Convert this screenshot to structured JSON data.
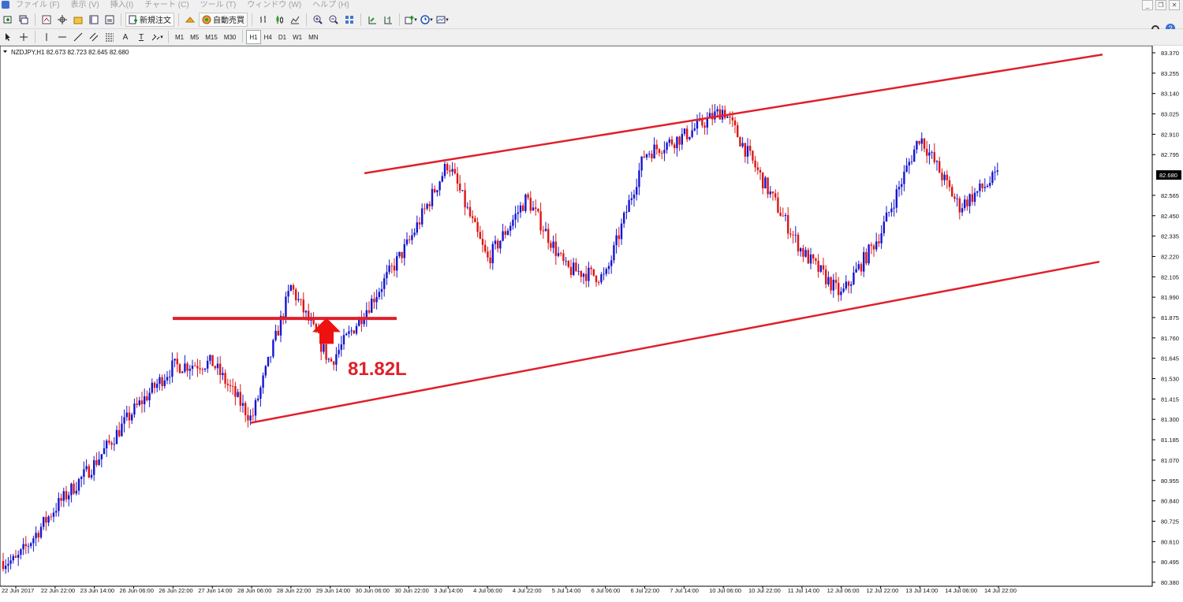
{
  "menu": {
    "items": [
      "ファイル (F)",
      "表示 (V)",
      "挿入(I)",
      "チャート (C)",
      "ツール (T)",
      "ウィンドウ (W)",
      "ヘルプ (H)"
    ]
  },
  "toolbar": {
    "new_order_label": "新規注文",
    "auto_trade_label": "自動売買",
    "draw_text_a": "A",
    "draw_text_t": "T",
    "timeframes": [
      "M1",
      "M5",
      "M15",
      "M30",
      "H1",
      "H4",
      "D1",
      "W1",
      "MN"
    ],
    "active_timeframe": "H1"
  },
  "chart": {
    "header": "NZDJPY,H1  82.673 82.723 82.645 82.680",
    "current_price": "82.680",
    "annotation": "81.82L",
    "colors": {
      "bull": "#1515d0",
      "bear": "#dd1515",
      "lines": "#e0202a",
      "arrow": "#ee1111"
    },
    "price_labels": [
      "83.370",
      "83.255",
      "83.140",
      "83.025",
      "82.910",
      "82.795",
      "82.565",
      "82.450",
      "82.335",
      "82.220",
      "82.105",
      "81.990",
      "81.875",
      "81.760",
      "81.645",
      "81.530",
      "81.415",
      "81.300",
      "81.185",
      "81.070",
      "80.955",
      "80.840",
      "80.725",
      "80.610",
      "80.495",
      "80.380"
    ],
    "time_labels": [
      "22 Jun 2017",
      "22 Jun 22:00",
      "23 Jun 14:00",
      "26 Jun 06:00",
      "26 Jun 22:00",
      "27 Jun 14:00",
      "28 Jun 06:00",
      "28 Jun 22:00",
      "29 Jun 14:00",
      "30 Jun 06:00",
      "30 Jun 22:00",
      "3 Jul 14:00",
      "4 Jul 06:00",
      "4 Jul 22:00",
      "5 Jul 14:00",
      "6 Jul 06:00",
      "6 Jul 22:00",
      "7 Jul 14:00",
      "10 Jul 06:00",
      "10 Jul 22:00",
      "11 Jul 14:00",
      "12 Jul 06:00",
      "12 Jul 22:00",
      "13 Jul 14:00",
      "14 Jul 06:00",
      "14 Jul 22:00"
    ]
  },
  "chart_data": {
    "type": "candlestick",
    "symbol": "NZDJPY",
    "timeframe": "H1",
    "ylim": [
      80.38,
      83.43
    ],
    "price_path_keypoints": [
      {
        "t": "22 Jun 2017",
        "price": 80.5
      },
      {
        "t": "22 Jun 22:00",
        "price": 80.8
      },
      {
        "t": "23 Jun 14:00",
        "price": 81.05
      },
      {
        "t": "26 Jun 06:00",
        "price": 81.35
      },
      {
        "t": "26 Jun 22:00",
        "price": 81.6
      },
      {
        "t": "27 Jun 14:00",
        "price": 81.62
      },
      {
        "t": "28 Jun 06:00",
        "price": 81.3
      },
      {
        "t": "28 Jun 22:00",
        "price": 82.05
      },
      {
        "t": "29 Jun 14:00",
        "price": 81.62
      },
      {
        "t": "30 Jun 06:00",
        "price": 81.95
      },
      {
        "t": "30 Jun 22:00",
        "price": 82.3
      },
      {
        "t": "3 Jul 14:00",
        "price": 82.75
      },
      {
        "t": "4 Jul 06:00",
        "price": 82.2
      },
      {
        "t": "4 Jul 22:00",
        "price": 82.55
      },
      {
        "t": "5 Jul 14:00",
        "price": 82.15
      },
      {
        "t": "6 Jul 06:00",
        "price": 82.1
      },
      {
        "t": "6 Jul 22:00",
        "price": 82.8
      },
      {
        "t": "7 Jul 14:00",
        "price": 82.9
      },
      {
        "t": "10 Jul 06:00",
        "price": 83.05
      },
      {
        "t": "10 Jul 22:00",
        "price": 82.65
      },
      {
        "t": "11 Jul 14:00",
        "price": 82.25
      },
      {
        "t": "12 Jul 06:00",
        "price": 82.0
      },
      {
        "t": "12 Jul 22:00",
        "price": 82.35
      },
      {
        "t": "13 Jul 14:00",
        "price": 82.9
      },
      {
        "t": "14 Jul 06:00",
        "price": 82.5
      },
      {
        "t": "14 Jul 22:00",
        "price": 82.68
      }
    ],
    "annotations": [
      {
        "type": "horizontal_segment",
        "price": 81.87,
        "from": "26 Jun 22:00",
        "to": "30 Jun 06:00"
      },
      {
        "type": "arrow_up",
        "at": "29 Jun 14:00",
        "price": 81.74
      },
      {
        "type": "text",
        "text": "81.82L",
        "price": 81.64
      },
      {
        "type": "channel_upper",
        "from": {
          "t": "3 Jul 06:00",
          "price": 82.69
        },
        "to": {
          "t": "14 Jul 22:00",
          "price": 83.36
        }
      },
      {
        "type": "channel_lower",
        "from": {
          "t": "28 Jun 06:00",
          "price": 81.28
        },
        "to": {
          "t": "14 Jul 22:00",
          "price": 82.19
        }
      }
    ]
  }
}
